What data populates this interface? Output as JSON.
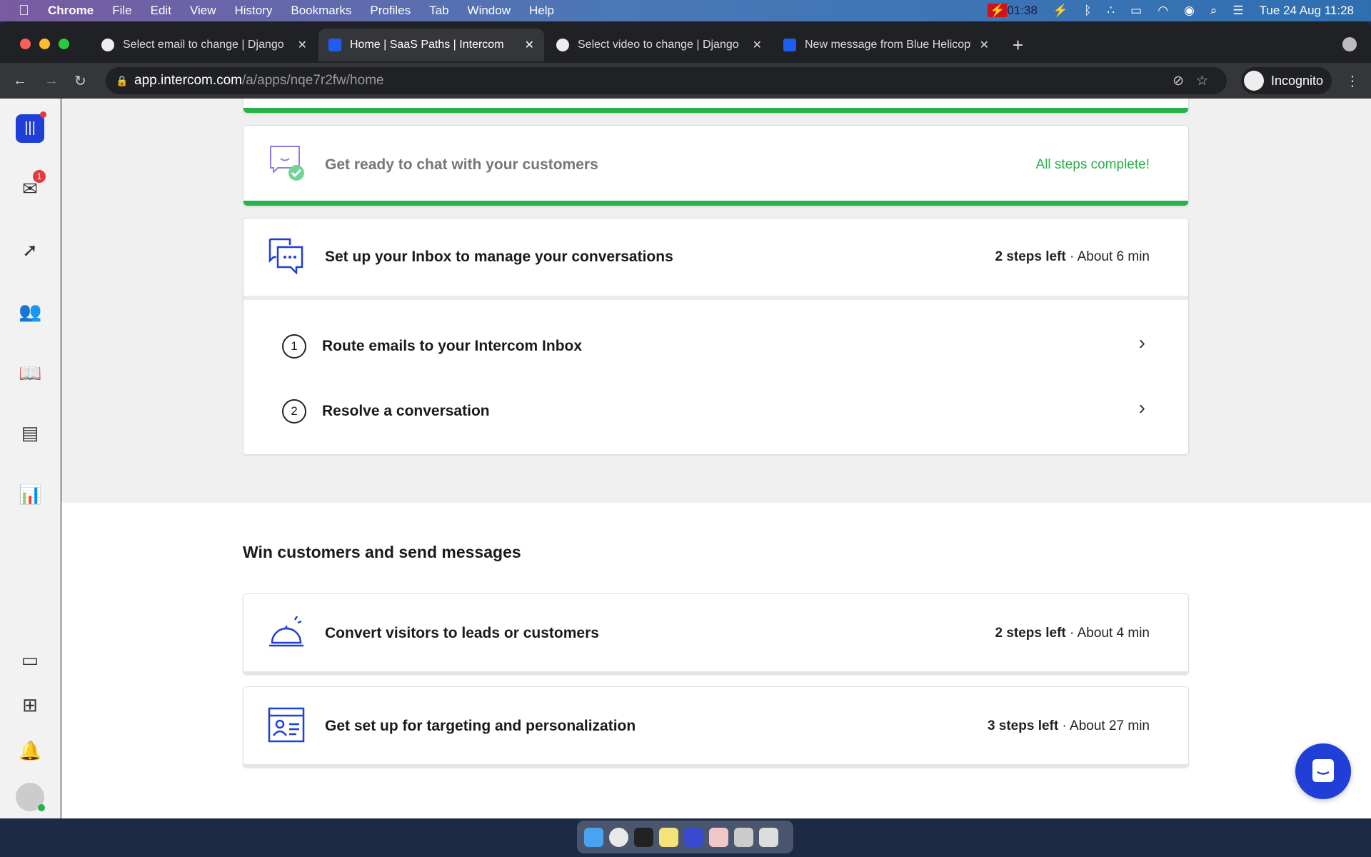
{
  "menubar": {
    "app": "Chrome",
    "items": [
      "File",
      "Edit",
      "View",
      "History",
      "Bookmarks",
      "Profiles",
      "Tab",
      "Window",
      "Help"
    ],
    "recording_time": "01:38",
    "datetime": "Tue 24 Aug  11:28"
  },
  "tabs": [
    {
      "title": "Select email to change | Django",
      "icon": "globe-icon"
    },
    {
      "title": "Home | SaaS Paths | Intercom",
      "icon": "intercom-icon",
      "active": true
    },
    {
      "title": "Select video to change | Django",
      "icon": "globe-icon"
    },
    {
      "title": "New message from Blue Helicopter",
      "icon": "intercom-icon"
    }
  ],
  "address": {
    "host": "app.intercom.com",
    "path": "/a/apps/nqe7r2fw/home"
  },
  "profile": "Incognito",
  "sidebar": {
    "inbox_badge": "1"
  },
  "cards": [
    {
      "title": "Get ready to chat with your customers",
      "status": "All steps complete!"
    },
    {
      "title": "Set up your Inbox to manage your conversations",
      "steps_left": "2 steps left",
      "time": " · About 6 min",
      "steps": [
        {
          "num": "1",
          "label": "Route emails to your Intercom Inbox"
        },
        {
          "num": "2",
          "label": "Resolve a conversation"
        }
      ]
    }
  ],
  "section2": {
    "heading": "Win customers and send messages",
    "cards": [
      {
        "title": "Convert visitors to leads or customers",
        "steps_left": "2 steps left",
        "time": " · About 4 min"
      },
      {
        "title": "Get set up for targeting and personalization",
        "steps_left": "3 steps left",
        "time": " · About 27 min"
      }
    ]
  },
  "colors": {
    "accent": "#1f3fd6",
    "complete": "#27b14b"
  }
}
